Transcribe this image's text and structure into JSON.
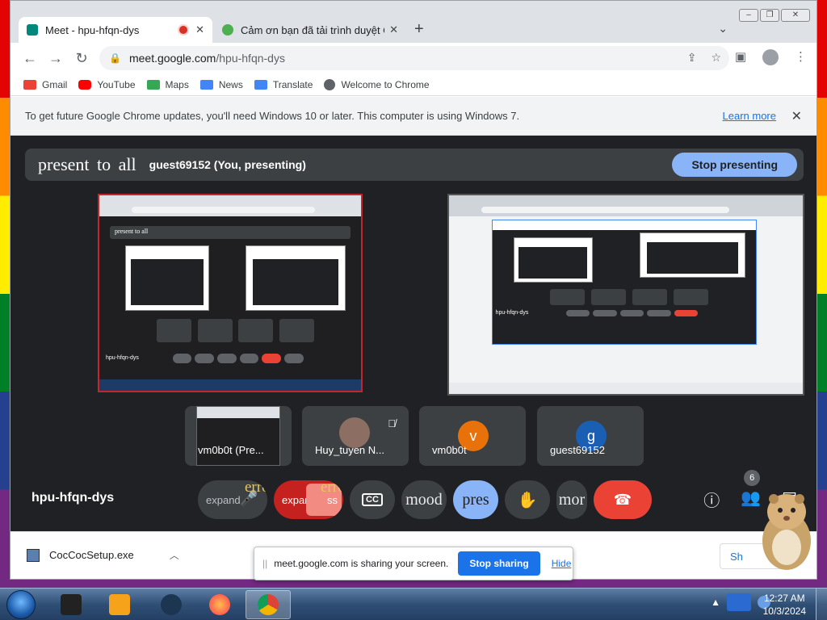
{
  "tabs": [
    {
      "title": "Meet - hpu-hfqn-dys",
      "favicon_color": "#00897b",
      "active": true,
      "recording": true
    },
    {
      "title": "Cảm ơn bạn đã tải trình duyệt Cốc",
      "favicon_color": "#4caf50",
      "active": false
    }
  ],
  "browser": {
    "url_host": "meet.google.com",
    "url_path": "/hpu-hfqn-dys"
  },
  "bookmarks": [
    {
      "label": "Gmail",
      "color": "#ea4335"
    },
    {
      "label": "YouTube",
      "color": "#ff0000"
    },
    {
      "label": "Maps",
      "color": "#34a853"
    },
    {
      "label": "News",
      "color": "#4285f4"
    },
    {
      "label": "Translate",
      "color": "#4285f4"
    },
    {
      "label": "Welcome to Chrome",
      "color": "#5f6368"
    }
  ],
  "infobar": {
    "message": "To get future Google Chrome updates, you'll need Windows 10 or later. This computer is using Windows 7.",
    "learn_more": "Learn more"
  },
  "meet": {
    "present_label": "present to all",
    "presenter": "guest69152 (You, presenting)",
    "stop_presenting": "Stop presenting",
    "meeting_code": "hpu-hfqn-dys",
    "participant_count": "6",
    "participants": [
      {
        "name": "vm0b0t (Pre...",
        "type": "screen"
      },
      {
        "name": "Huy_tuyen N...",
        "type": "photo",
        "muted": true
      },
      {
        "name": "vm0b0t",
        "type": "initial",
        "initial": "v",
        "color": "#e8710a"
      },
      {
        "name": "guest69152",
        "type": "initial",
        "initial": "g",
        "color": "#1a5fb4"
      }
    ],
    "controls": {
      "mic_text": "expand",
      "mic_error": "error",
      "cam_text": "expand",
      "cam_suffix": "ss",
      "cam_error": "error",
      "captions": "CC",
      "mood": "mood",
      "present": "pres",
      "more": "mor"
    }
  },
  "downloads": {
    "file": "CocCocSetup.exe",
    "show_all": "Sh"
  },
  "sharing": {
    "message": "meet.google.com is sharing your screen.",
    "stop_sharing": "Stop sharing",
    "hide": "Hide"
  },
  "clock": {
    "time": "12:27 AM",
    "date": "10/3/2024"
  },
  "screen_thumbnails": {
    "left_code": "hpu-hfqn-dys",
    "left_pres": "present to all",
    "right_code": "hpu-hfqn-dys"
  }
}
